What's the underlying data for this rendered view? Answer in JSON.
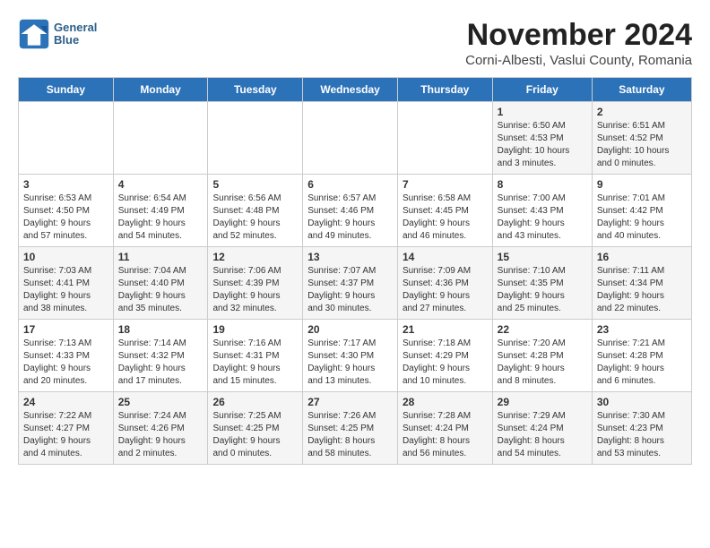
{
  "logo": {
    "line1": "General",
    "line2": "Blue"
  },
  "title": "November 2024",
  "subtitle": "Corni-Albesti, Vaslui County, Romania",
  "weekdays": [
    "Sunday",
    "Monday",
    "Tuesday",
    "Wednesday",
    "Thursday",
    "Friday",
    "Saturday"
  ],
  "weeks": [
    [
      {
        "day": "",
        "info": ""
      },
      {
        "day": "",
        "info": ""
      },
      {
        "day": "",
        "info": ""
      },
      {
        "day": "",
        "info": ""
      },
      {
        "day": "",
        "info": ""
      },
      {
        "day": "1",
        "info": "Sunrise: 6:50 AM\nSunset: 4:53 PM\nDaylight: 10 hours\nand 3 minutes."
      },
      {
        "day": "2",
        "info": "Sunrise: 6:51 AM\nSunset: 4:52 PM\nDaylight: 10 hours\nand 0 minutes."
      }
    ],
    [
      {
        "day": "3",
        "info": "Sunrise: 6:53 AM\nSunset: 4:50 PM\nDaylight: 9 hours\nand 57 minutes."
      },
      {
        "day": "4",
        "info": "Sunrise: 6:54 AM\nSunset: 4:49 PM\nDaylight: 9 hours\nand 54 minutes."
      },
      {
        "day": "5",
        "info": "Sunrise: 6:56 AM\nSunset: 4:48 PM\nDaylight: 9 hours\nand 52 minutes."
      },
      {
        "day": "6",
        "info": "Sunrise: 6:57 AM\nSunset: 4:46 PM\nDaylight: 9 hours\nand 49 minutes."
      },
      {
        "day": "7",
        "info": "Sunrise: 6:58 AM\nSunset: 4:45 PM\nDaylight: 9 hours\nand 46 minutes."
      },
      {
        "day": "8",
        "info": "Sunrise: 7:00 AM\nSunset: 4:43 PM\nDaylight: 9 hours\nand 43 minutes."
      },
      {
        "day": "9",
        "info": "Sunrise: 7:01 AM\nSunset: 4:42 PM\nDaylight: 9 hours\nand 40 minutes."
      }
    ],
    [
      {
        "day": "10",
        "info": "Sunrise: 7:03 AM\nSunset: 4:41 PM\nDaylight: 9 hours\nand 38 minutes."
      },
      {
        "day": "11",
        "info": "Sunrise: 7:04 AM\nSunset: 4:40 PM\nDaylight: 9 hours\nand 35 minutes."
      },
      {
        "day": "12",
        "info": "Sunrise: 7:06 AM\nSunset: 4:39 PM\nDaylight: 9 hours\nand 32 minutes."
      },
      {
        "day": "13",
        "info": "Sunrise: 7:07 AM\nSunset: 4:37 PM\nDaylight: 9 hours\nand 30 minutes."
      },
      {
        "day": "14",
        "info": "Sunrise: 7:09 AM\nSunset: 4:36 PM\nDaylight: 9 hours\nand 27 minutes."
      },
      {
        "day": "15",
        "info": "Sunrise: 7:10 AM\nSunset: 4:35 PM\nDaylight: 9 hours\nand 25 minutes."
      },
      {
        "day": "16",
        "info": "Sunrise: 7:11 AM\nSunset: 4:34 PM\nDaylight: 9 hours\nand 22 minutes."
      }
    ],
    [
      {
        "day": "17",
        "info": "Sunrise: 7:13 AM\nSunset: 4:33 PM\nDaylight: 9 hours\nand 20 minutes."
      },
      {
        "day": "18",
        "info": "Sunrise: 7:14 AM\nSunset: 4:32 PM\nDaylight: 9 hours\nand 17 minutes."
      },
      {
        "day": "19",
        "info": "Sunrise: 7:16 AM\nSunset: 4:31 PM\nDaylight: 9 hours\nand 15 minutes."
      },
      {
        "day": "20",
        "info": "Sunrise: 7:17 AM\nSunset: 4:30 PM\nDaylight: 9 hours\nand 13 minutes."
      },
      {
        "day": "21",
        "info": "Sunrise: 7:18 AM\nSunset: 4:29 PM\nDaylight: 9 hours\nand 10 minutes."
      },
      {
        "day": "22",
        "info": "Sunrise: 7:20 AM\nSunset: 4:28 PM\nDaylight: 9 hours\nand 8 minutes."
      },
      {
        "day": "23",
        "info": "Sunrise: 7:21 AM\nSunset: 4:28 PM\nDaylight: 9 hours\nand 6 minutes."
      }
    ],
    [
      {
        "day": "24",
        "info": "Sunrise: 7:22 AM\nSunset: 4:27 PM\nDaylight: 9 hours\nand 4 minutes."
      },
      {
        "day": "25",
        "info": "Sunrise: 7:24 AM\nSunset: 4:26 PM\nDaylight: 9 hours\nand 2 minutes."
      },
      {
        "day": "26",
        "info": "Sunrise: 7:25 AM\nSunset: 4:25 PM\nDaylight: 9 hours\nand 0 minutes."
      },
      {
        "day": "27",
        "info": "Sunrise: 7:26 AM\nSunset: 4:25 PM\nDaylight: 8 hours\nand 58 minutes."
      },
      {
        "day": "28",
        "info": "Sunrise: 7:28 AM\nSunset: 4:24 PM\nDaylight: 8 hours\nand 56 minutes."
      },
      {
        "day": "29",
        "info": "Sunrise: 7:29 AM\nSunset: 4:24 PM\nDaylight: 8 hours\nand 54 minutes."
      },
      {
        "day": "30",
        "info": "Sunrise: 7:30 AM\nSunset: 4:23 PM\nDaylight: 8 hours\nand 53 minutes."
      }
    ]
  ]
}
